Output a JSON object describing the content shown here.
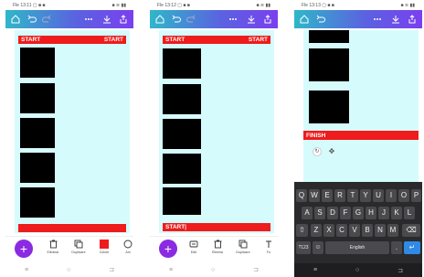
{
  "screens": [
    {
      "status_left": "Fle 13:11 ▢ ■ ■",
      "status_right": "■ ≋ ▮▮",
      "appbar": {
        "icons": [
          "home-icon",
          "undo-icon",
          "redo-icon",
          "more-icon",
          "download-icon",
          "share-icon"
        ]
      },
      "top_label_left": "START",
      "top_label_right": "START",
      "bottom_label": "",
      "toolbar": [
        {
          "icon": "eraser-icon",
          "label": "Eliminar"
        },
        {
          "icon": "copy-icon",
          "label": "Duplicare"
        },
        {
          "icon": "color-swatch",
          "label": "Colore"
        },
        {
          "icon": "animate-icon",
          "label": "Ani"
        }
      ]
    },
    {
      "status_left": "Fle 13:12 ▢ ■ ■",
      "status_right": "■ ≋ ▮▮",
      "appbar": {
        "icons": [
          "home-icon",
          "undo-icon",
          "redo-icon",
          "more-icon",
          "download-icon",
          "share-icon"
        ]
      },
      "top_label_left": "START",
      "top_label_right": "START",
      "bottom_label": "START|",
      "toolbar": [
        {
          "icon": "edit-icon",
          "label": "Edit"
        },
        {
          "icon": "eraser-icon",
          "label": "Elimina"
        },
        {
          "icon": "copy-icon",
          "label": "Duplicare"
        },
        {
          "icon": "text-icon",
          "label": "Fo"
        }
      ]
    },
    {
      "status_left": "Fle 13:13 ▢ ■ ■",
      "status_right": "■ ≋ ▮▮",
      "appbar": {
        "icons": [
          "home-icon",
          "undo-icon",
          "more-icon",
          "download-icon",
          "share-icon"
        ]
      },
      "finish_label": "FINISH",
      "keyboard": {
        "row1": [
          "Q",
          "W",
          "E",
          "R",
          "T",
          "Y",
          "U",
          "I",
          "O",
          "P"
        ],
        "row2": [
          "A",
          "S",
          "D",
          "F",
          "G",
          "H",
          "J",
          "K",
          "L"
        ],
        "row3": [
          "⇧",
          "Z",
          "X",
          "C",
          "V",
          "B",
          "N",
          "M",
          "⌫"
        ],
        "row4": [
          "?123",
          "☺",
          "English",
          ".",
          "↵"
        ]
      }
    }
  ],
  "nav": {
    "back": "≡",
    "home": "○",
    "recent": "⊐"
  },
  "colors": {
    "accent": "#8a2be2",
    "red": "#ee1c1c",
    "canvas": "#d6fbfd"
  }
}
